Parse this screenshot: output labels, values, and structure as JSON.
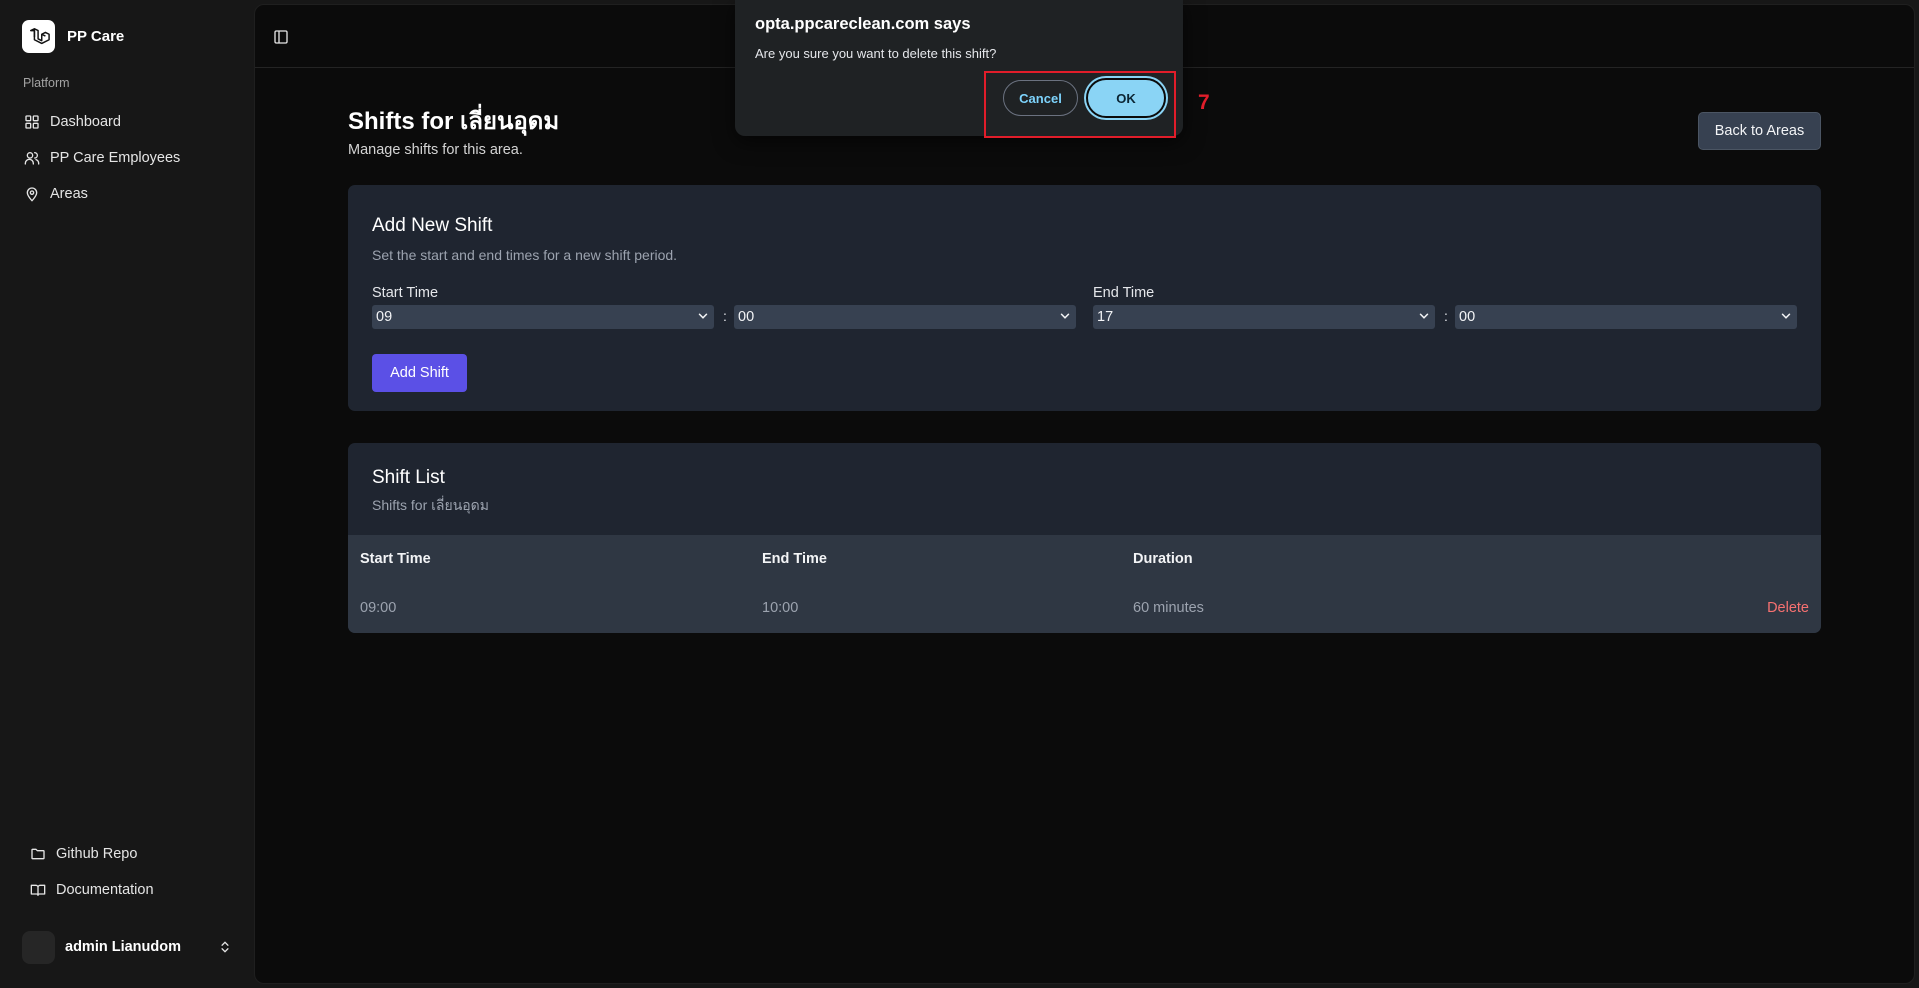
{
  "sidebar": {
    "brand": "PP Care",
    "section_heading": "Platform",
    "items": [
      {
        "label": "Dashboard",
        "icon": "grid-icon"
      },
      {
        "label": "PP Care Employees",
        "icon": "users-icon"
      },
      {
        "label": "Areas",
        "icon": "map-pin-icon"
      }
    ],
    "bottom_links": [
      {
        "label": "Github Repo",
        "icon": "folder-icon"
      },
      {
        "label": "Documentation",
        "icon": "book-icon"
      }
    ],
    "user": {
      "name": "admin Lianudom"
    }
  },
  "page": {
    "title": "Shifts for เลี่ยนอุดม",
    "subtitle": "Manage shifts for this area.",
    "back_button": "Back to Areas"
  },
  "add_shift": {
    "title": "Add New Shift",
    "description": "Set the start and end times for a new shift period.",
    "start_label": "Start Time",
    "end_label": "End Time",
    "start_hour": "09",
    "start_minute": "00",
    "end_hour": "17",
    "end_minute": "00",
    "separator": ":",
    "button": "Add Shift"
  },
  "shift_list": {
    "title": "Shift List",
    "subtitle": "Shifts for เลี่ยนอุดม",
    "columns": [
      "Start Time",
      "End Time",
      "Duration"
    ],
    "rows": [
      {
        "start": "09:00",
        "end": "10:00",
        "duration": "60 minutes",
        "action": "Delete"
      }
    ]
  },
  "dialog": {
    "title": "opta.ppcareclean.com says",
    "message": "Are you sure you want to delete this shift?",
    "cancel": "Cancel",
    "ok": "OK"
  },
  "annotation": {
    "number": "7",
    "color": "#e11d2a"
  },
  "colors": {
    "accent": "#5b50e6",
    "danger": "#f87171",
    "dialog_ok": "#8ad4f5",
    "dialog_link": "#7dd3fc"
  }
}
